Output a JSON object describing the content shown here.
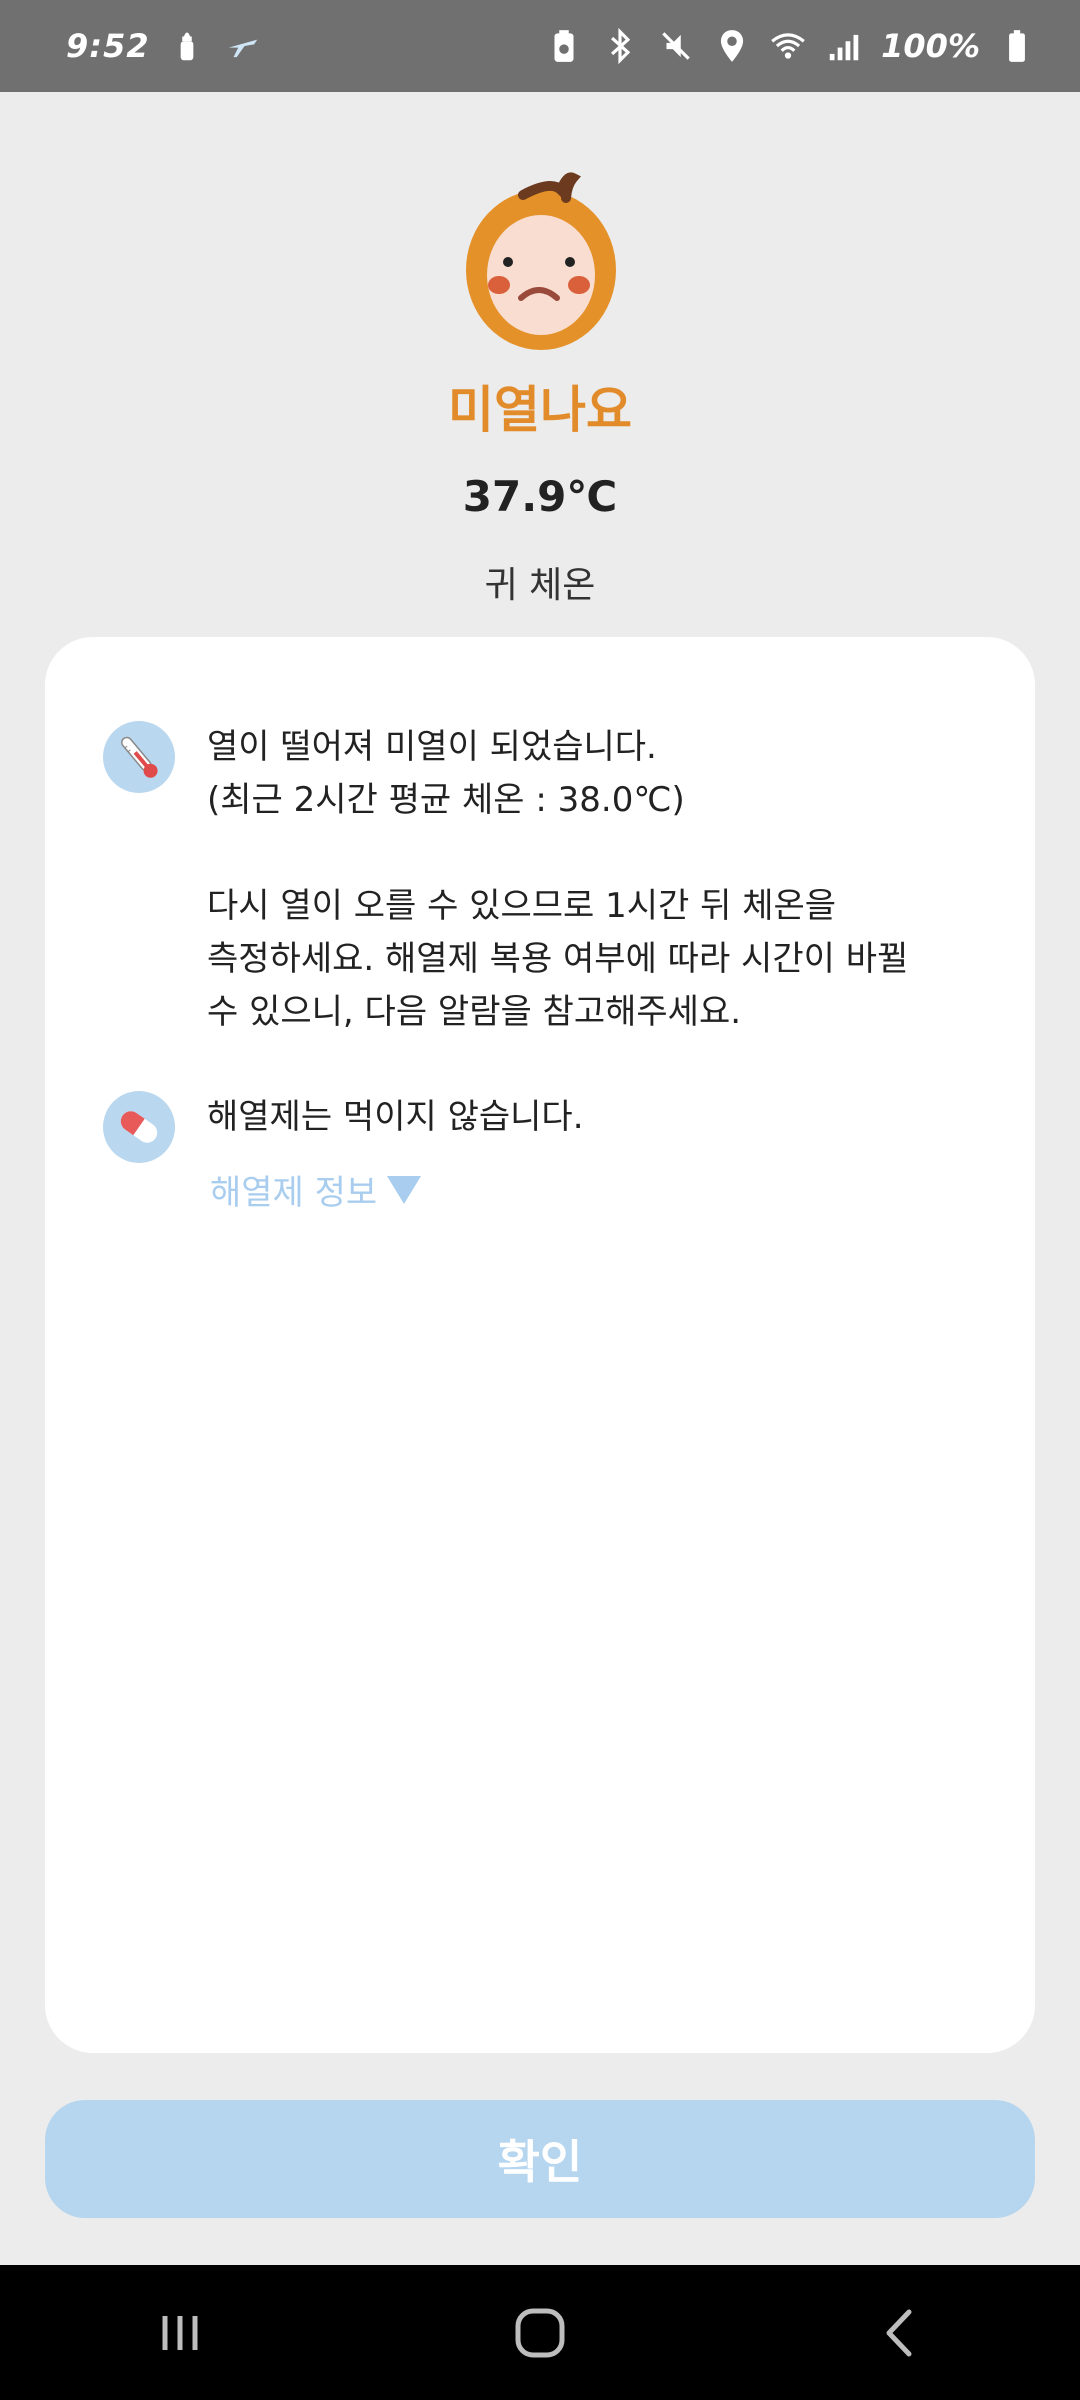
{
  "status_bar": {
    "time": "9:52",
    "battery": "100%",
    "icons": [
      "baby-bottle-icon",
      "plane-icon",
      "battery-saver-icon",
      "bluetooth-icon",
      "mute-icon",
      "location-icon",
      "wifi-icon",
      "signal-icon",
      "battery-icon"
    ]
  },
  "header": {
    "face_icon": "sick-baby-face-icon",
    "status": "미열나요",
    "temperature": "37.9℃",
    "method": "귀 체온"
  },
  "card": {
    "temperature_message": {
      "icon": "thermometer-icon",
      "line1": "열이 떨어져 미열이 되었습니다.",
      "line2": "(최근 2시간 평균 체온 :  38.0℃)",
      "para2_line1": "다시 열이 오를 수 있으므로 1시간 뒤 체온을",
      "para2_line2": "측정하세요. 해열제 복용 여부에 따라 시간이 바뀔",
      "para2_line3": "수 있으니, 다음 알람을 참고해주세요."
    },
    "medicine_message": {
      "icon": "pill-icon",
      "text": "해열제는 먹이지 않습니다.",
      "link": "해열제 정보"
    }
  },
  "confirm_button": "확인",
  "colors": {
    "accent_orange": "#e28b2a",
    "light_blue": "#b6d6f0",
    "link_blue": "#a9cdee",
    "background": "#ececec"
  }
}
